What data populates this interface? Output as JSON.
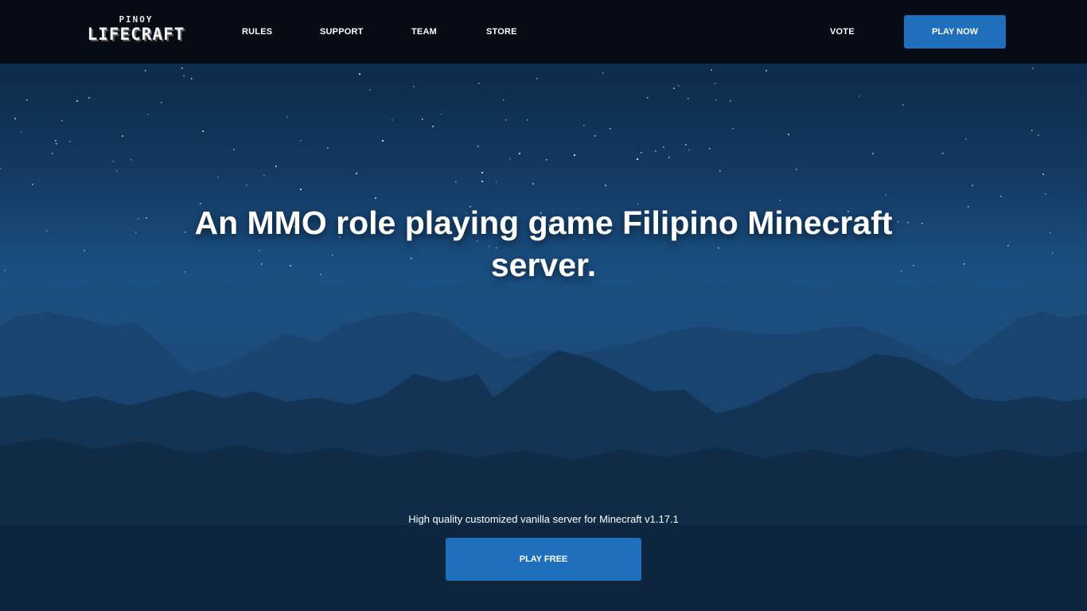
{
  "brand": {
    "logo_top": "PINOY",
    "logo_main": "LIFECRAFT"
  },
  "nav": {
    "rules": "RULES",
    "support": "SUPPORT",
    "team": "TEAM",
    "store": "STORE",
    "vote": "VOTE",
    "play_now": "PLAY NOW"
  },
  "hero": {
    "headline": "An MMO role playing game Filipino Minecraft server.",
    "subtitle": "High quality customized vanilla server for Minecraft v1.17.1",
    "cta": "PLAY FREE"
  },
  "colors": {
    "navbar_bg": "#060b14",
    "accent_button": "#1f6fbd",
    "sky_top": "#0b2440",
    "sky_horizon": "#1e5a92"
  }
}
